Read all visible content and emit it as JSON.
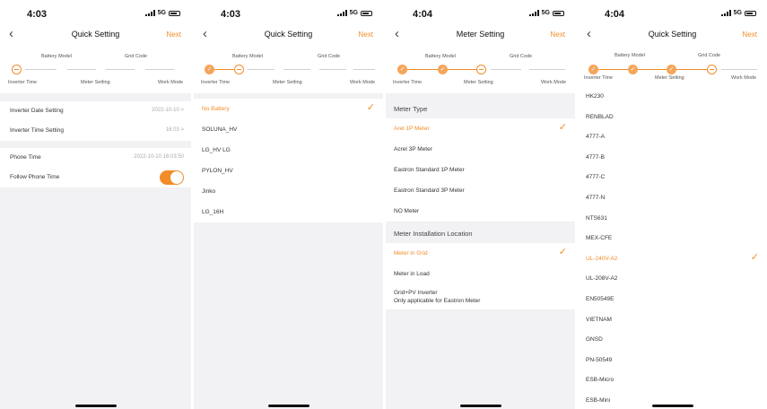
{
  "colors": {
    "accent": "#f28c28",
    "background": "#f2f2f4"
  },
  "icons": {
    "back": "chevron-left-icon",
    "check": "checkmark-icon"
  },
  "screen1": {
    "time": "4:03",
    "network": "5G",
    "title": "Quick Setting",
    "next": "Next",
    "back": "‹",
    "steps": {
      "top": [
        "Battery Model",
        "Grid Code"
      ],
      "bottom": [
        "Inverter Time",
        "Meter Setting",
        "Work Mode"
      ]
    },
    "rows": [
      {
        "label": "Inverter Date Setting",
        "value": "2022-10-10 >"
      },
      {
        "label": "Inverter Time Setting",
        "value": "16:03 >"
      }
    ],
    "phone_time": {
      "label": "Phone Time",
      "value": "2022-10-10 16:03:50"
    },
    "follow": {
      "label": "Follow Phone Time",
      "on": true
    }
  },
  "screen2": {
    "time": "4:03",
    "network": "5G",
    "title": "Quick Setting",
    "next": "Next",
    "back": "‹",
    "steps": {
      "top": [
        "Battery Model",
        "Grid Code"
      ],
      "bottom": [
        "Inverter Time",
        "Meter Setting",
        "Work Mode"
      ]
    },
    "items": [
      "No Battery",
      "SOLUNA_HV",
      "LG_HV LG",
      "PYLON_HV",
      "Jinko",
      "LG_16H"
    ],
    "selected": "No Battery",
    "check": "✓"
  },
  "screen3": {
    "time": "4:04",
    "network": "5G",
    "title": "Meter Setting",
    "next": "Next",
    "back": "‹",
    "steps": {
      "top": [
        "Battery Model",
        "Grid Code"
      ],
      "bottom": [
        "Inverter Time",
        "Meter Setting",
        "Work Mode"
      ]
    },
    "meter_type_header": "Meter Type",
    "meter_types": [
      "Arel 1P Meter",
      "Acrel 3P Meter",
      "Eastron Standard 1P Meter",
      "Eastron Standard 3P Meter",
      "NO Meter"
    ],
    "meter_type_selected": "Arel 1P Meter",
    "location_header": "Meter Installation Location",
    "locations": [
      "Meter in Grid",
      "Meter in Load"
    ],
    "location_selected": "Meter in Grid",
    "location_extra": {
      "line1": "Grid+PV Inverter",
      "line2": "Only applicable for Eastron Meter"
    },
    "check": "✓"
  },
  "screen4": {
    "time": "4:04",
    "network": "5G",
    "title": "Quick Setting",
    "next": "Next",
    "back": "‹",
    "steps": {
      "top": [
        "Battery Model",
        "Grid Code"
      ],
      "bottom": [
        "Inverter Time",
        "Meter Setting",
        "Work Mode"
      ]
    },
    "items": [
      "HK230",
      "RENBLAD",
      "4777-A",
      "4777-B",
      "4777-C",
      "4777-N",
      "NTS631",
      "MEX-CFE",
      "UL-240V-A2",
      "UL-208V-A2",
      "EN50549E",
      "VIETNAM",
      "GNSD",
      "PN-50549",
      "ESB-Micro",
      "ESB-Mini"
    ],
    "selected": "UL-240V-A2",
    "check": "✓"
  }
}
